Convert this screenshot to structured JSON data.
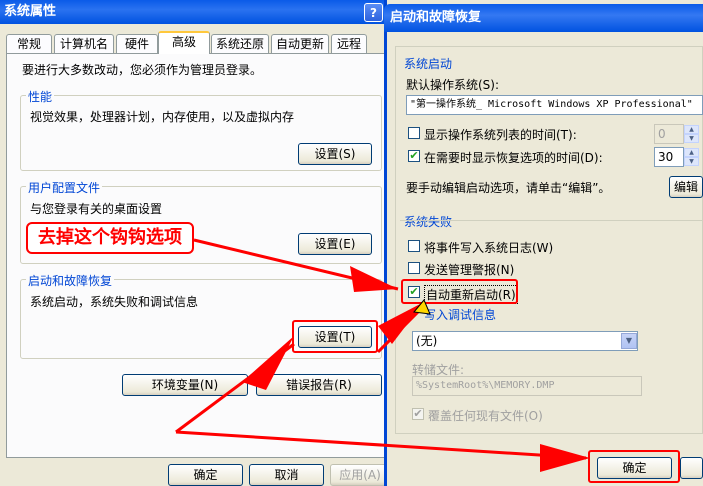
{
  "left_window": {
    "title": "系统属性",
    "help_btn": "?",
    "close_btn": "×",
    "tabs": [
      "常规",
      "计算机名",
      "硬件",
      "高级",
      "系统还原",
      "自动更新",
      "远程"
    ],
    "admin_note": "要进行大多数改动，您必须作为管理员登录。",
    "performance": {
      "legend": "性能",
      "desc": "视觉效果，处理器计划，内存使用，以及虚拟内存",
      "button": "设置(S)"
    },
    "user_profiles": {
      "legend": "用户配置文件",
      "desc": "与您登录有关的桌面设置",
      "button": "设置(E)"
    },
    "startup_recovery": {
      "legend": "启动和故障恢复",
      "desc": "系统启动，系统失败和调试信息",
      "button": "设置(T)"
    },
    "env_button": "环境变量(N)",
    "error_button": "错误报告(R)",
    "ok_button": "确定",
    "cancel_button": "取消",
    "apply_button": "应用(A)"
  },
  "annotation": "去掉这个钩钩选项",
  "right_window": {
    "title": "启动和故障恢复",
    "system_startup": {
      "section": "系统启动",
      "default_os_label": "默认操作系统(S):",
      "default_os_value": "\"第一操作系统_ Microsoft Windows XP Professional\"",
      "show_list_label": "显示操作系统列表的时间(T):",
      "show_list_checked": false,
      "show_list_value": "0",
      "show_recovery_label": "在需要时显示恢复选项的时间(D):",
      "show_recovery_checked": true,
      "show_recovery_value": "30",
      "edit_note": "要手动编辑启动选项，请单击“编辑”。",
      "edit_button": "编辑"
    },
    "system_failure": {
      "section": "系统失败",
      "write_event_label": "将事件写入系统日志(W)",
      "write_event_checked": false,
      "send_alert_label": "发送管理警报(N)",
      "send_alert_checked": false,
      "auto_restart_label": "自动重新启动(R)",
      "auto_restart_checked": true,
      "debug_section": "写入调试信息",
      "debug_select_value": "(无)",
      "dump_file_label": "转储文件:",
      "dump_file_value": "%SystemRoot%\\MEMORY.DMP",
      "overwrite_label": "覆盖任何现有文件(O)",
      "overwrite_checked": true
    },
    "ok_button": "确定",
    "checkmark": "✔"
  },
  "colors": {
    "accent": "#0046d5",
    "annotation_red": "#ff0000",
    "title_blue": "#0a5be8"
  }
}
